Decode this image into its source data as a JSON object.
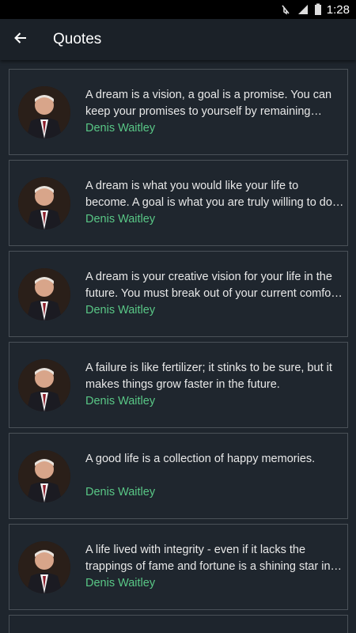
{
  "status": {
    "time": "1:28"
  },
  "header": {
    "title": "Quotes"
  },
  "quotes": [
    {
      "text": "A dream is a vision, a goal is a promise. You can keep your promises to yourself by remaining…",
      "author": "Denis Waitley"
    },
    {
      "text": "A dream is what you would like your life to become. A goal is what you are truly willing to do…",
      "author": "Denis Waitley"
    },
    {
      "text": "A dream is your creative vision for your life in the future. You must break out of your current comfo…",
      "author": "Denis Waitley"
    },
    {
      "text": "A failure is like fertilizer; it stinks to be sure, but it makes things grow faster in the future.",
      "author": "Denis Waitley"
    },
    {
      "text": "A good life is a collection of happy memories.",
      "author": "Denis Waitley"
    },
    {
      "text": "A life lived with integrity - even if it lacks the trappings of fame and fortune is a shining star in…",
      "author": "Denis Waitley"
    }
  ],
  "colors": {
    "accent": "#59c786",
    "background": "#1e252d",
    "appbar": "#1b2128"
  },
  "icons": {
    "back": "arrow-left-icon"
  }
}
